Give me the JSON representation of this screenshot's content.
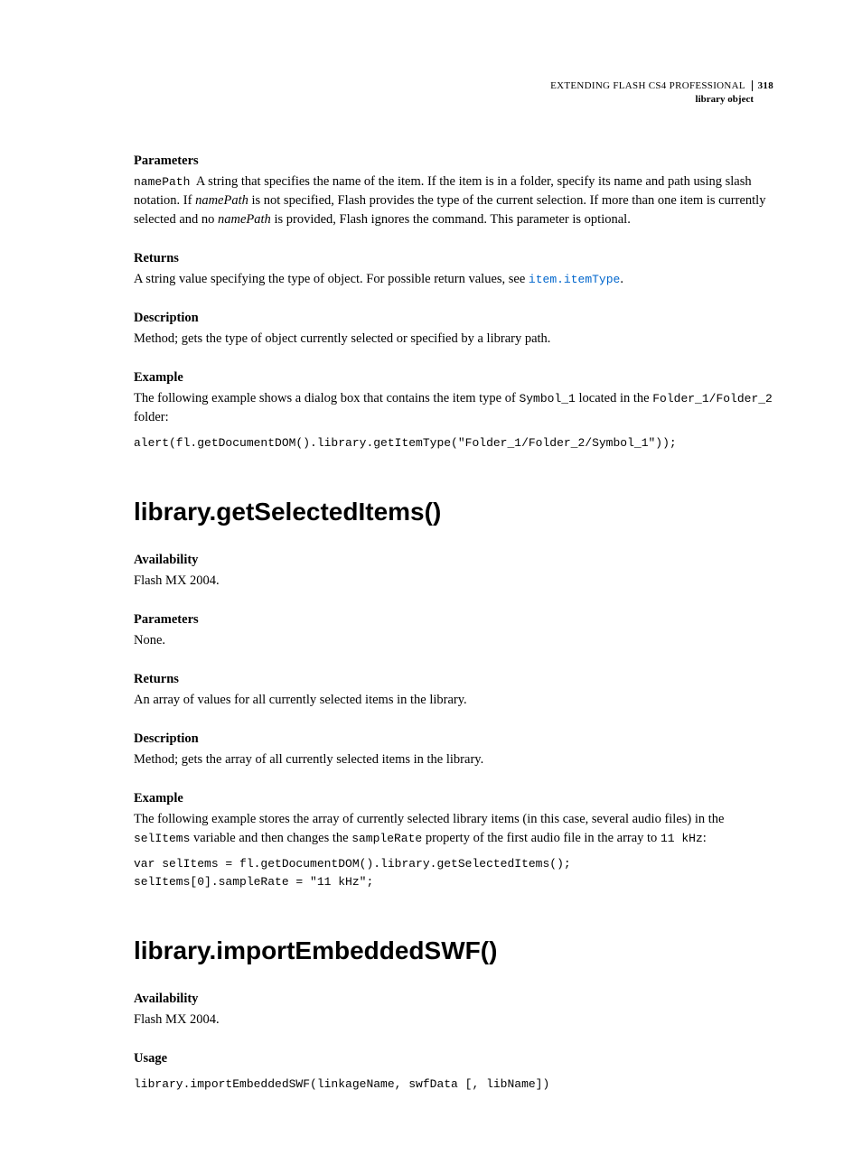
{
  "header": {
    "book_title": "EXTENDING FLASH CS4 PROFESSIONAL",
    "page_number": "318",
    "section_title": "library object"
  },
  "sec1": {
    "parameters_label": "Parameters",
    "param_name": "namePath",
    "param_desc_a": "A string that specifies the name of the item. If the item is in a folder, specify its name and path using slash notation. If ",
    "param_italic": "namePath",
    "param_desc_b": " is not specified, Flash provides the type of the current selection. If more than one item is currently selected and no ",
    "param_italic2": "namePath",
    "param_desc_c": " is provided, Flash ignores the command. This parameter is optional.",
    "returns_label": "Returns",
    "returns_text_a": "A string value specifying the type of object. For possible return values, see ",
    "returns_link": "item.itemType",
    "returns_text_b": ".",
    "description_label": "Description",
    "description_text": "Method; gets the type of object currently selected or specified by a library path.",
    "example_label": "Example",
    "example_text_a": "The following example shows a dialog box that contains the item type of ",
    "example_mono1": "Symbol_1",
    "example_text_b": " located in the ",
    "example_mono2": "Folder_1/Folder_2",
    "example_text_c": " folder:",
    "example_code": "alert(fl.getDocumentDOM().library.getItemType(\"Folder_1/Folder_2/Symbol_1\"));"
  },
  "sec2": {
    "title": "library.getSelectedItems()",
    "availability_label": "Availability",
    "availability_text": "Flash MX 2004.",
    "parameters_label": "Parameters",
    "parameters_text": "None.",
    "returns_label": "Returns",
    "returns_text": "An array of values for all currently selected items in the library.",
    "description_label": "Description",
    "description_text": "Method; gets the array of all currently selected items in the library.",
    "example_label": "Example",
    "example_text_a": "The following example stores the array of currently selected library items (in this case, several audio files) in the ",
    "example_mono1": "selItems",
    "example_text_b": " variable and then changes the ",
    "example_mono2": "sampleRate",
    "example_text_c": " property of the first audio file in the array to ",
    "example_mono3": "11 kHz",
    "example_text_d": ":",
    "example_code": "var selItems = fl.getDocumentDOM().library.getSelectedItems();\nselItems[0].sampleRate = \"11 kHz\";"
  },
  "sec3": {
    "title": "library.importEmbeddedSWF()",
    "availability_label": "Availability",
    "availability_text": "Flash MX 2004.",
    "usage_label": "Usage",
    "usage_code": "library.importEmbeddedSWF(linkageName, swfData [, libName])"
  }
}
